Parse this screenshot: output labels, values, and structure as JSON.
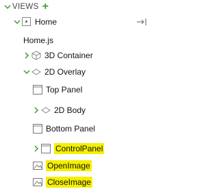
{
  "views": {
    "header_label": "VIEWS",
    "add_icon": "plus-icon"
  },
  "tree": {
    "home": {
      "label": "Home"
    },
    "home_js": {
      "label": "Home.js"
    },
    "container_3d": {
      "label": "3D Container"
    },
    "overlay_2d": {
      "label": "2D Overlay"
    },
    "top_panel": {
      "label": "Top Panel"
    },
    "body_2d": {
      "label": "2D Body"
    },
    "bottom_panel": {
      "label": "Bottom Panel"
    },
    "control_panel": {
      "label": "ControlPanel"
    },
    "open_image": {
      "label": "OpenImage"
    },
    "close_image": {
      "label": "CloseImage"
    }
  },
  "colors": {
    "chevron": "#3c9c2e",
    "highlight": "#f5ef00"
  }
}
